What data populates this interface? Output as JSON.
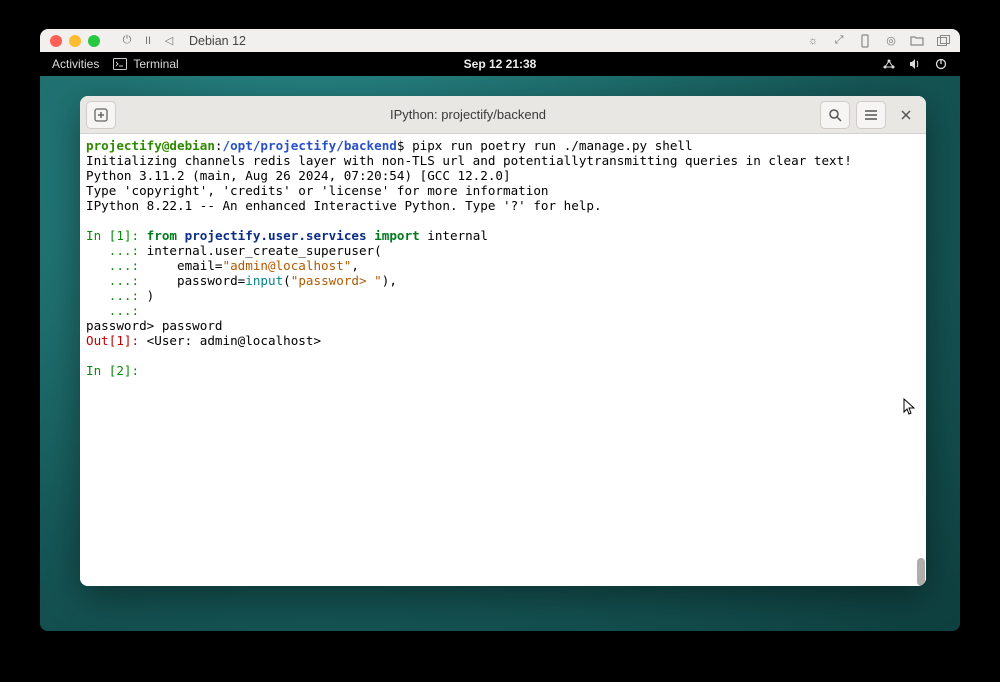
{
  "mac": {
    "title": "Debian 12",
    "icons": [
      "power",
      "pause",
      "back"
    ]
  },
  "gnome": {
    "activities": "Activities",
    "app": "Terminal",
    "clock": "Sep 12  21:38"
  },
  "terminal": {
    "title": "IPython: projectify/backend",
    "prompt_user": "projectify@debian",
    "prompt_path": "/opt/projectify/backend",
    "prompt_cmd": "pipx run poetry run ./manage.py shell",
    "line_init": "Initializing channels redis layer with non-TLS url and potentiallytransmitting queries in clear text!",
    "line_py": "Python 3.11.2 (main, Aug 26 2024, 07:20:54) [GCC 12.2.0]",
    "line_help": "Type 'copyright', 'credits' or 'license' for more information",
    "line_ipy": "IPython 8.22.1 -- An enhanced Interactive Python. Type '?' for help.",
    "in1": "In [1]:",
    "cont": "   ...:",
    "in2": "In [2]:",
    "out1": "Out[1]:",
    "kw_from": "from",
    "mod": "projectify.user.services",
    "kw_import": "import",
    "imp_name": " internal",
    "code_l2": " internal.user_create_superuser(",
    "code_l3a": "     email=",
    "str_email": "\"admin@localhost\"",
    "code_l3b": ",",
    "code_l4a": "     password=",
    "fn_input": "input",
    "code_l4b": "(",
    "str_pw": "\"password> \"",
    "code_l4c": "),",
    "code_l5": " )",
    "pw_line": "password> password",
    "out_val": " <User: admin@localhost>"
  }
}
